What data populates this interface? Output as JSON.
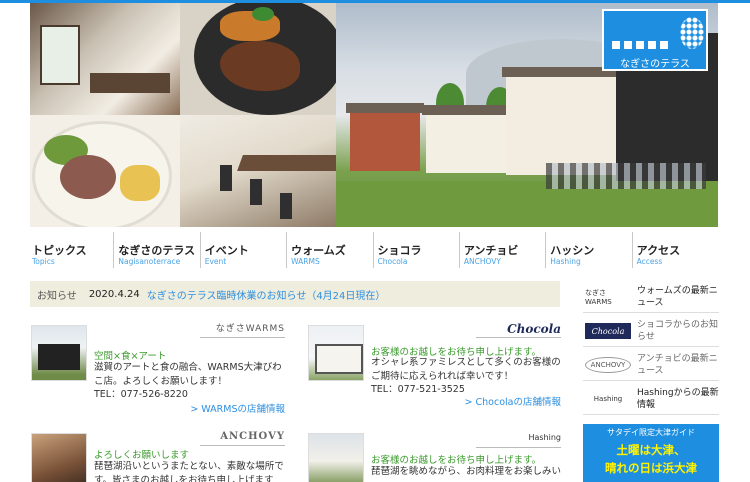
{
  "site": {
    "logo_text": "なぎさのテラス"
  },
  "nav": [
    {
      "jp": "トピックス",
      "en": "Topics"
    },
    {
      "jp": "なぎさのテラス",
      "en": "Nagisanoterrace"
    },
    {
      "jp": "イベント",
      "en": "Event"
    },
    {
      "jp": "ウォームズ",
      "en": "WARMS"
    },
    {
      "jp": "ショコラ",
      "en": "Chocola"
    },
    {
      "jp": "アンチョビ",
      "en": "ANCHOVY"
    },
    {
      "jp": "ハッシン",
      "en": "Hashing"
    },
    {
      "jp": "アクセス",
      "en": "Access"
    }
  ],
  "news": {
    "label": "お知らせ",
    "date": "2020.4.24",
    "link": "なぎさのテラス臨時休業のお知らせ（4月24日現在）"
  },
  "cards": {
    "warms": {
      "logo": "なぎさWARMS",
      "title": "空間×食×アート",
      "text": "滋賀のアートと食の融合、WARMS大津びわこ店。よろしくお願いします！",
      "tel": "TEL：077-526-8220",
      "more": "> WARMSの店舗情報"
    },
    "chocola": {
      "logo": "Chocola",
      "title": "お客様のお越しをお待ち申し上げます。",
      "text": "オシャレ系ファミレスとして多くのお客様のご期待に応えられれば幸いです！",
      "tel": "TEL：077-521-3525",
      "more": "> Chocolaの店舗情報"
    },
    "anchovy": {
      "logo": "ANCHOVY",
      "title": "よろしくお願いします",
      "text": "琵琶湖沿いというまたとない、素敵な場所です。皆さまのお越しをお待ち申し上げます"
    },
    "hashing": {
      "logo": "Hashing",
      "title": "お客様のお越しをお待ち申し上げます。",
      "text": "琵琶湖を眺めながら、お肉料理をお楽しみい"
    }
  },
  "sidebar": [
    {
      "logo": "なぎさWARMS",
      "text": "ウォームズの最新ニュース"
    },
    {
      "logo": "Chocola",
      "text": "ショコラからのお知らせ"
    },
    {
      "logo": "ANCHOVY",
      "text": "アンチョビの最新ニュース"
    },
    {
      "logo": "Hashing",
      "text": "Hashingからの最新情報"
    }
  ],
  "banner": {
    "top": "サタデイ限定大津ガイド",
    "line1": "土曜は大津、",
    "line2": "晴れの日は浜大津"
  }
}
